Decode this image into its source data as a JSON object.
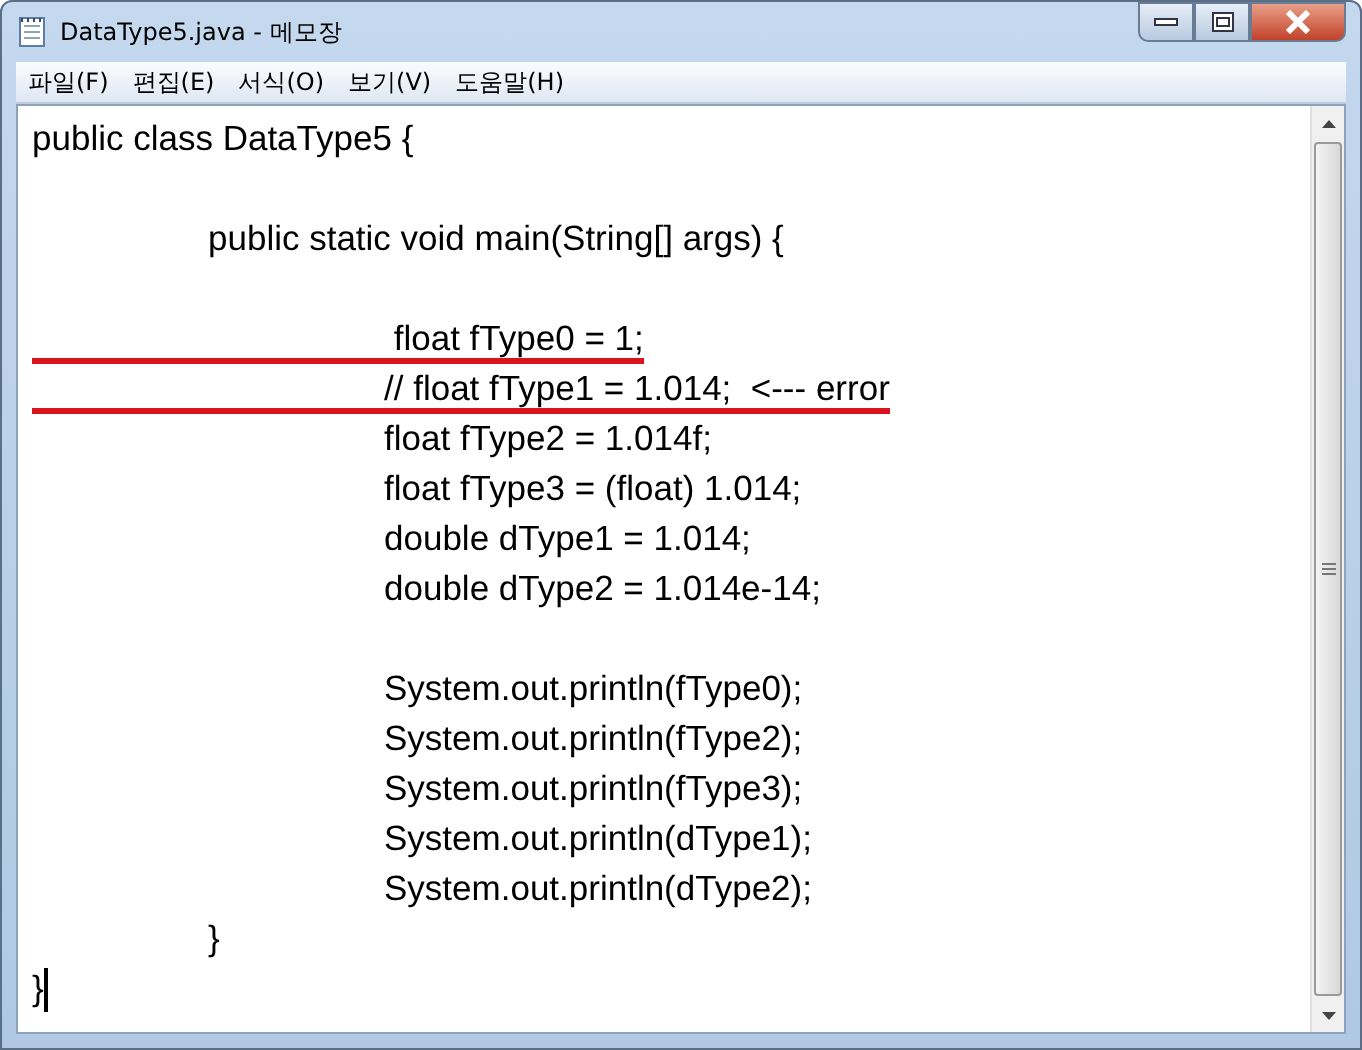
{
  "window": {
    "title": "DataType5.java - 메모장"
  },
  "menu": [
    {
      "label": "파일(F)"
    },
    {
      "label": "편집(E)"
    },
    {
      "label": "서식(O)"
    },
    {
      "label": "보기(V)"
    },
    {
      "label": "도움말(H)"
    }
  ],
  "editor": {
    "lines": [
      {
        "kind": "code",
        "text": "public class DataType5 {",
        "underlined": false
      },
      {
        "kind": "blank"
      },
      {
        "kind": "code",
        "text": "\tpublic static void main(String[] args) {",
        "underlined": false
      },
      {
        "kind": "blank"
      },
      {
        "kind": "code",
        "text": "\t\t float fType0 = 1;",
        "underlined": true
      },
      {
        "kind": "code",
        "text": "\t\t// float fType1 = 1.014;  <--- error",
        "underlined": true
      },
      {
        "kind": "code",
        "text": "\t\tfloat fType2 = 1.014f;",
        "underlined": false
      },
      {
        "kind": "code",
        "text": "\t\tfloat fType3 = (float) 1.014;",
        "underlined": false
      },
      {
        "kind": "code",
        "text": "\t\tdouble dType1 = 1.014;",
        "underlined": false
      },
      {
        "kind": "code",
        "text": "\t\tdouble dType2 = 1.014e-14;",
        "underlined": false
      },
      {
        "kind": "blank"
      },
      {
        "kind": "code",
        "text": "\t\tSystem.out.println(fType0);",
        "underlined": false
      },
      {
        "kind": "code",
        "text": "\t\tSystem.out.println(fType2);",
        "underlined": false
      },
      {
        "kind": "code",
        "text": "\t\tSystem.out.println(fType3);",
        "underlined": false
      },
      {
        "kind": "code",
        "text": "\t\tSystem.out.println(dType1);",
        "underlined": false
      },
      {
        "kind": "code",
        "text": "\t\tSystem.out.println(dType2);",
        "underlined": false
      },
      {
        "kind": "code",
        "text": "\t}",
        "underlined": false
      },
      {
        "kind": "code",
        "text": "}",
        "underlined": false,
        "cursor": true
      }
    ]
  }
}
